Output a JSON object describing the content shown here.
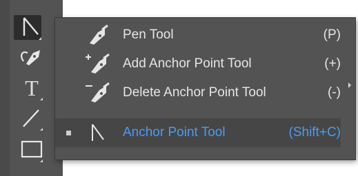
{
  "toolbar": {
    "tools": [
      {
        "name": "direct-selection-tool",
        "icon": "direct-selection-arrow-icon",
        "selected": true
      },
      {
        "name": "curvature-tool",
        "icon": "curvature-pen-icon",
        "selected": false
      },
      {
        "name": "type-tool",
        "icon": "type-t-icon",
        "glyph": "T",
        "selected": false
      },
      {
        "name": "line-segment-tool",
        "icon": "line-segment-icon",
        "selected": false
      },
      {
        "name": "rectangle-tool",
        "icon": "rectangle-icon",
        "selected": false
      }
    ]
  },
  "flyout": {
    "items": [
      {
        "label": "Pen Tool",
        "shortcut": "(P)",
        "icon": "pen-icon",
        "active": false
      },
      {
        "label": "Add Anchor Point Tool",
        "shortcut": "(+)",
        "icon": "add-anchor-point-icon",
        "active": false
      },
      {
        "label": "Delete Anchor Point Tool",
        "shortcut": "(-)",
        "icon": "delete-anchor-point-icon",
        "active": false
      },
      {
        "label": "Anchor Point Tool",
        "shortcut": "(Shift+C)",
        "icon": "anchor-point-icon",
        "active": true
      }
    ]
  },
  "colors": {
    "panel": "#535353",
    "highlight_text": "#4a9cf5",
    "text": "#e6e6e6"
  }
}
